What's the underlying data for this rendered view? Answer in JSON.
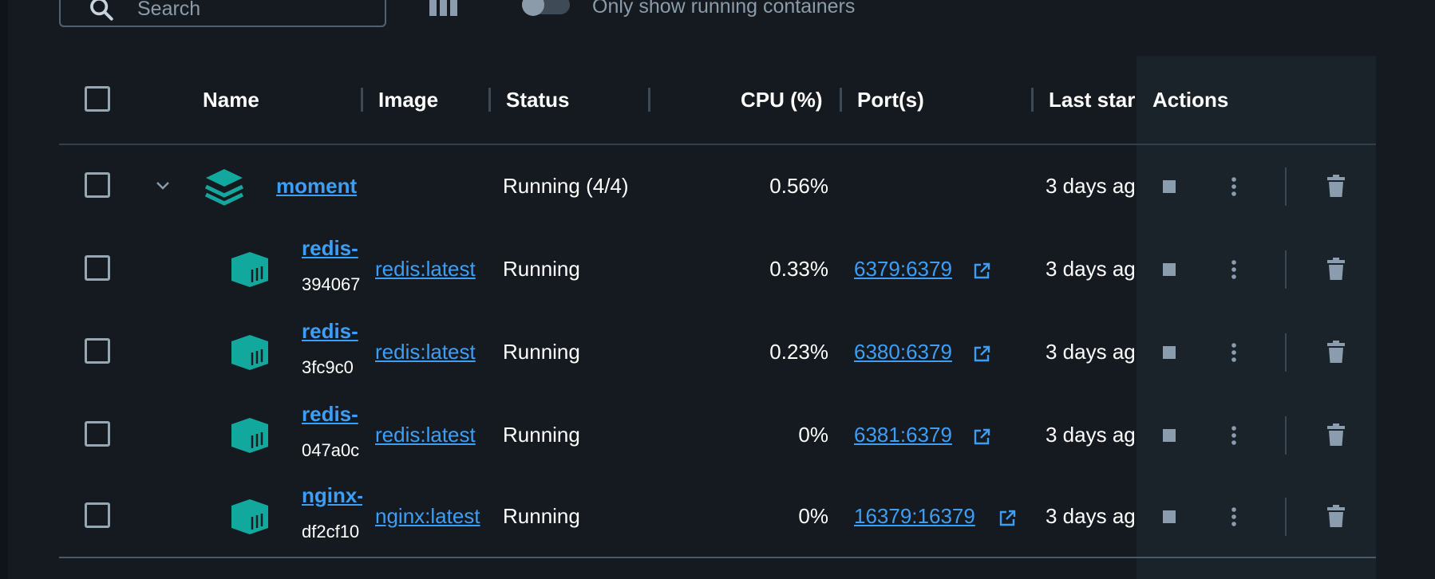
{
  "toolbar": {
    "search_placeholder": "Search",
    "toggle_label": "Only show running containers"
  },
  "table": {
    "headers": {
      "name": "Name",
      "image": "Image",
      "status": "Status",
      "cpu": "CPU (%)",
      "ports": "Port(s)",
      "last_started": "Last star",
      "actions": "Actions"
    },
    "rows": [
      {
        "name": "moment",
        "id": "",
        "image": "",
        "status": "Running (4/4)",
        "cpu": "0.56%",
        "port": "",
        "last_started": "3 days ag",
        "kind": "stack"
      },
      {
        "name": "redis-",
        "id": "394067",
        "image": "redis:latest",
        "status": "Running",
        "cpu": "0.33%",
        "port": "6379:6379",
        "last_started": "3 days ag",
        "kind": "container"
      },
      {
        "name": "redis-",
        "id": "3fc9c0",
        "image": "redis:latest",
        "status": "Running",
        "cpu": "0.23%",
        "port": "6380:6379",
        "last_started": "3 days ag",
        "kind": "container"
      },
      {
        "name": "redis-",
        "id": "047a0c",
        "image": "redis:latest",
        "status": "Running",
        "cpu": "0%",
        "port": "6381:6379",
        "last_started": "3 days ag",
        "kind": "container"
      },
      {
        "name": "nginx-",
        "id": "df2cf10",
        "image": "nginx:latest",
        "status": "Running",
        "cpu": "0%",
        "port": "16379:16379",
        "last_started": "3 days ag",
        "kind": "container"
      }
    ]
  },
  "colors": {
    "background": "#141a1f",
    "link": "#3d9ef7",
    "accent_teal": "#13a89e",
    "icon_grey": "#8a9cad"
  },
  "icons": {
    "search": "search-icon",
    "columns": "columns-icon",
    "stack": "stack-layers-icon",
    "container": "container-cube-icon",
    "external": "external-link-icon",
    "stop": "stop-icon",
    "more": "more-vertical-icon",
    "delete": "trash-icon",
    "expand": "chevron-down-icon"
  }
}
